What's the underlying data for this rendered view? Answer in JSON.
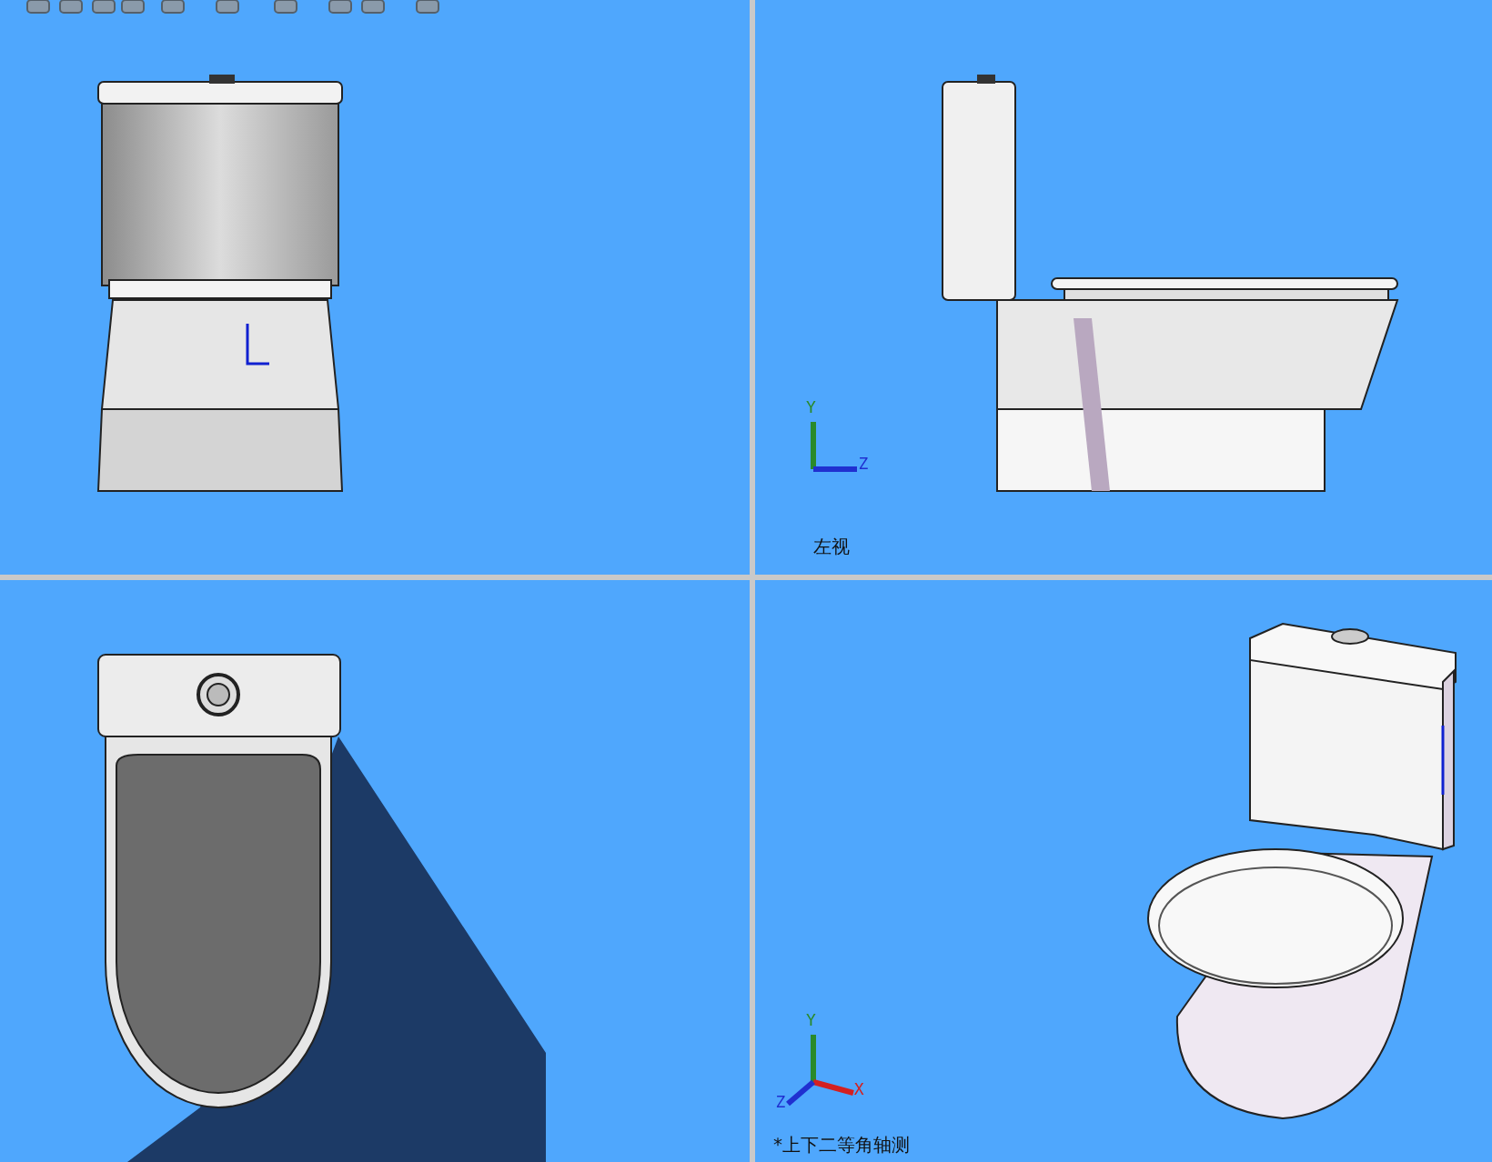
{
  "viewports": [
    {
      "kind": "front"
    },
    {
      "kind": "side",
      "label": "左视",
      "triad": [
        {
          "kind": "y",
          "label": "Y"
        },
        {
          "kind": "z",
          "label": "Z"
        }
      ]
    },
    {
      "kind": "top"
    },
    {
      "kind": "iso",
      "label": "*上下二等角轴测",
      "triad": [
        {
          "kind": "y",
          "label": "Y"
        },
        {
          "kind": "x",
          "label": "X"
        },
        {
          "kind": "z",
          "label": "Z"
        }
      ]
    }
  ]
}
